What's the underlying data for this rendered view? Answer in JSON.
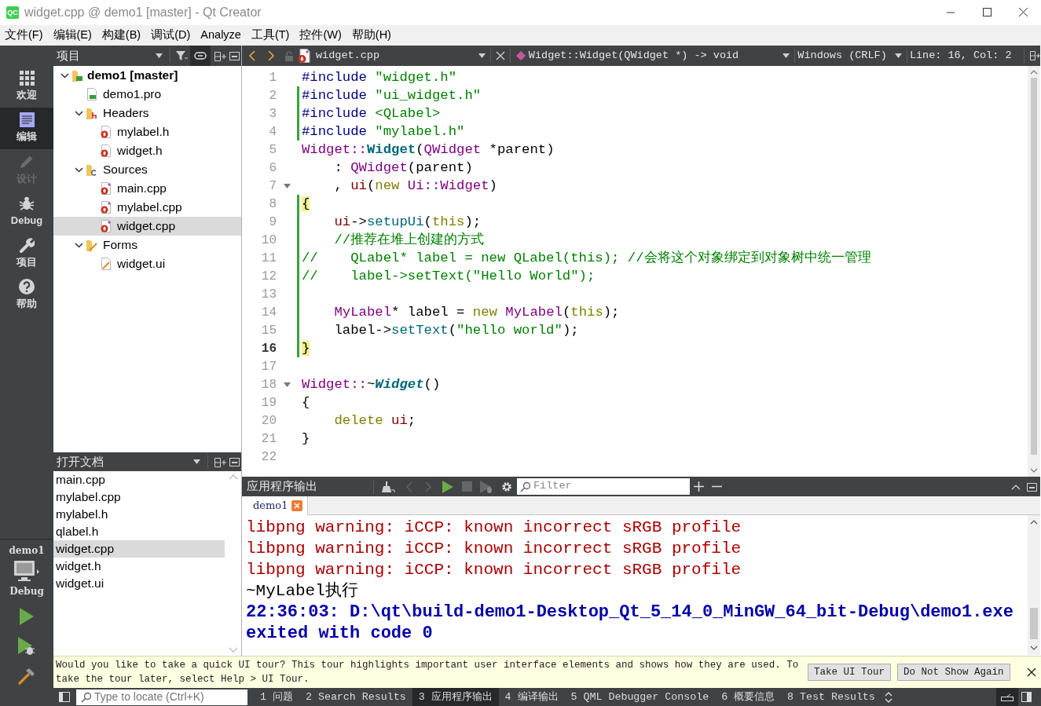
{
  "window": {
    "logo": "QC",
    "title": "widget.cpp @ demo1 [master] - Qt Creator"
  },
  "menu": [
    "文件(F)",
    "编辑(E)",
    "构建(B)",
    "调试(D)",
    "Analyze",
    "工具(T)",
    "控件(W)",
    "帮助(H)"
  ],
  "mode_bar": {
    "modes": [
      {
        "label": "欢迎",
        "kind": "welcome",
        "selected": false,
        "disabled": false
      },
      {
        "label": "编辑",
        "kind": "edit",
        "selected": true,
        "disabled": false
      },
      {
        "label": "设计",
        "kind": "design",
        "selected": false,
        "disabled": true
      },
      {
        "label": "Debug",
        "kind": "debug",
        "selected": false,
        "disabled": false
      },
      {
        "label": "项目",
        "kind": "projects",
        "selected": false,
        "disabled": false
      },
      {
        "label": "帮助",
        "kind": "help",
        "selected": false,
        "disabled": false
      }
    ],
    "kit": {
      "project": "demo1",
      "build": "Debug"
    }
  },
  "project_panel": {
    "title": "项目",
    "tree": [
      {
        "label": "demo1 [master]",
        "kind": "project",
        "expanded": true,
        "selected": false,
        "children": [
          {
            "label": "demo1.pro",
            "kind": "pro",
            "selected": false
          },
          {
            "label": "Headers",
            "kind": "folder-headers",
            "expanded": true,
            "selected": false,
            "children": [
              {
                "label": "mylabel.h",
                "kind": "header",
                "selected": false
              },
              {
                "label": "widget.h",
                "kind": "header",
                "selected": false
              }
            ]
          },
          {
            "label": "Sources",
            "kind": "folder-sources",
            "expanded": true,
            "selected": false,
            "children": [
              {
                "label": "main.cpp",
                "kind": "source",
                "selected": false
              },
              {
                "label": "mylabel.cpp",
                "kind": "source",
                "selected": false
              },
              {
                "label": "widget.cpp",
                "kind": "source",
                "selected": true
              }
            ]
          },
          {
            "label": "Forms",
            "kind": "folder-forms",
            "expanded": true,
            "selected": false,
            "children": [
              {
                "label": "widget.ui",
                "kind": "form",
                "selected": false
              }
            ]
          }
        ]
      }
    ]
  },
  "open_documents": {
    "title": "打开文档",
    "items": [
      {
        "label": "main.cpp",
        "selected": false
      },
      {
        "label": "mylabel.cpp",
        "selected": false
      },
      {
        "label": "mylabel.h",
        "selected": false
      },
      {
        "label": "qlabel.h",
        "selected": false
      },
      {
        "label": "widget.cpp",
        "selected": true
      },
      {
        "label": "widget.h",
        "selected": false
      },
      {
        "label": "widget.ui",
        "selected": false
      }
    ]
  },
  "editor": {
    "file": "widget.cpp",
    "symbol": "Widget::Widget(QWidget *) -> void",
    "line_ending": "Windows (CRLF)",
    "position": "Line: 16, Col: 2",
    "lines": [
      {
        "number": "1",
        "changed": false,
        "current": false,
        "foldable": false,
        "tokens": [
          {
            "text": "#include",
            "kind": "preproc"
          },
          {
            "text": " \"widget.h\"",
            "kind": "string"
          }
        ]
      },
      {
        "number": "2",
        "changed": true,
        "current": false,
        "foldable": false,
        "tokens": [
          {
            "text": "#include",
            "kind": "preproc"
          },
          {
            "text": " \"ui_widget.h\"",
            "kind": "string"
          }
        ]
      },
      {
        "number": "3",
        "changed": true,
        "current": false,
        "foldable": false,
        "tokens": [
          {
            "text": "#include",
            "kind": "preproc"
          },
          {
            "text": " <QLabel>",
            "kind": "string"
          }
        ]
      },
      {
        "number": "4",
        "changed": true,
        "current": false,
        "foldable": false,
        "tokens": [
          {
            "text": "#include",
            "kind": "preproc"
          },
          {
            "text": " \"mylabel.h\"",
            "kind": "string"
          }
        ]
      },
      {
        "number": "5",
        "changed": false,
        "current": false,
        "foldable": false,
        "tokens": [
          {
            "text": "Widget::",
            "kind": "type"
          },
          {
            "text": "Widget",
            "kind": "func-def"
          },
          {
            "text": "(",
            "kind": "plain"
          },
          {
            "text": "QWidget",
            "kind": "type"
          },
          {
            "text": " *parent)",
            "kind": "plain"
          }
        ]
      },
      {
        "number": "6",
        "changed": false,
        "current": false,
        "foldable": false,
        "tokens": [
          {
            "text": "    : ",
            "kind": "plain"
          },
          {
            "text": "QWidget",
            "kind": "type"
          },
          {
            "text": "(parent)",
            "kind": "plain"
          }
        ]
      },
      {
        "number": "7",
        "changed": false,
        "current": false,
        "foldable": true,
        "tokens": [
          {
            "text": "    , ",
            "kind": "plain"
          },
          {
            "text": "ui",
            "kind": "member"
          },
          {
            "text": "(",
            "kind": "plain"
          },
          {
            "text": "new",
            "kind": "keyword"
          },
          {
            "text": " Ui::Widget",
            "kind": "type"
          },
          {
            "text": ")",
            "kind": "plain"
          }
        ]
      },
      {
        "number": "8",
        "changed": true,
        "current": false,
        "foldable": false,
        "tokens": [
          {
            "text": "{",
            "kind": "brace"
          }
        ]
      },
      {
        "number": "9",
        "changed": true,
        "current": false,
        "foldable": false,
        "tokens": [
          {
            "text": "    ui",
            "kind": "member"
          },
          {
            "text": "->",
            "kind": "plain"
          },
          {
            "text": "setupUi",
            "kind": "func"
          },
          {
            "text": "(",
            "kind": "plain"
          },
          {
            "text": "this",
            "kind": "keyword"
          },
          {
            "text": ");",
            "kind": "plain"
          }
        ]
      },
      {
        "number": "10",
        "changed": true,
        "current": false,
        "foldable": false,
        "tokens": [
          {
            "text": "    //推荐在堆上创建的方式",
            "kind": "comment"
          }
        ]
      },
      {
        "number": "11",
        "changed": true,
        "current": false,
        "foldable": false,
        "tokens": [
          {
            "text": "//    QLabel* label = new QLabel(this); //会将这个对象绑定到对象树中统一管理",
            "kind": "comment"
          }
        ]
      },
      {
        "number": "12",
        "changed": true,
        "current": false,
        "foldable": false,
        "tokens": [
          {
            "text": "//    label->setText(\"Hello World\");",
            "kind": "comment"
          }
        ]
      },
      {
        "number": "13",
        "changed": true,
        "current": false,
        "foldable": false
      },
      {
        "number": "14",
        "changed": true,
        "current": false,
        "foldable": false,
        "tokens": [
          {
            "text": "    MyLabel",
            "kind": "type"
          },
          {
            "text": "* label = ",
            "kind": "plain"
          },
          {
            "text": "new",
            "kind": "keyword"
          },
          {
            "text": " MyLabel",
            "kind": "type"
          },
          {
            "text": "(",
            "kind": "plain"
          },
          {
            "text": "this",
            "kind": "keyword"
          },
          {
            "text": ");",
            "kind": "plain"
          }
        ]
      },
      {
        "number": "15",
        "changed": true,
        "current": false,
        "foldable": false,
        "tokens": [
          {
            "text": "    label->",
            "kind": "plain"
          },
          {
            "text": "setText",
            "kind": "func"
          },
          {
            "text": "(",
            "kind": "plain"
          },
          {
            "text": "\"hello world\"",
            "kind": "string"
          },
          {
            "text": ");",
            "kind": "plain"
          }
        ]
      },
      {
        "number": "16",
        "changed": true,
        "current": true,
        "foldable": false,
        "tokens": [
          {
            "text": "}",
            "kind": "brace"
          }
        ]
      },
      {
        "number": "17",
        "changed": false,
        "current": false,
        "foldable": false
      },
      {
        "number": "18",
        "changed": false,
        "current": false,
        "foldable": true,
        "tokens": [
          {
            "text": "Widget::",
            "kind": "type"
          },
          {
            "text": "~",
            "kind": "plain"
          },
          {
            "text": "Widget",
            "kind": "dtor-def"
          },
          {
            "text": "()",
            "kind": "plain"
          }
        ]
      },
      {
        "number": "19",
        "changed": false,
        "current": false,
        "foldable": false,
        "tokens": [
          {
            "text": "{",
            "kind": "plain"
          }
        ]
      },
      {
        "number": "20",
        "changed": false,
        "current": false,
        "foldable": false,
        "tokens": [
          {
            "text": "    delete",
            "kind": "keyword"
          },
          {
            "text": " ui",
            "kind": "member"
          },
          {
            "text": ";",
            "kind": "plain"
          }
        ]
      },
      {
        "number": "21",
        "changed": false,
        "current": false,
        "foldable": false,
        "tokens": [
          {
            "text": "}",
            "kind": "plain"
          }
        ]
      },
      {
        "number": "22",
        "changed": false,
        "current": false,
        "foldable": false
      }
    ]
  },
  "output": {
    "title": "应用程序输出",
    "filter_placeholder": "Filter",
    "tabs": [
      {
        "label": "demo1",
        "selected": true
      }
    ],
    "lines": [
      {
        "text": "libpng warning: iCCP: known incorrect sRGB profile",
        "kind": "error"
      },
      {
        "text": "libpng warning: iCCP: known incorrect sRGB profile",
        "kind": "error"
      },
      {
        "text": "libpng warning: iCCP: known incorrect sRGB profile",
        "kind": "error"
      },
      {
        "text": "~MyLabel执行",
        "kind": "plain"
      },
      {
        "text": "22:36:03: D:\\qt\\build-demo1-Desktop_Qt_5_14_0_MinGW_64_bit-Debug\\demo1.exe exited with code 0",
        "kind": "info"
      }
    ]
  },
  "info_bar": {
    "message": "Would you like to take a quick UI tour? This tour highlights important user interface elements and shows how they are used. To take the tour later, select Help > UI Tour.",
    "buttons": [
      "Take UI Tour",
      "Do Not Show Again"
    ]
  },
  "status_bar": {
    "locator_placeholder": "Type to locate (Ctrl+K)",
    "panes": [
      {
        "label": "1 问题",
        "selected": false
      },
      {
        "label": "2 Search Results",
        "selected": false
      },
      {
        "label": "3 应用程序输出",
        "selected": true
      },
      {
        "label": "4 编译输出",
        "selected": false
      },
      {
        "label": "5 QML Debugger Console",
        "selected": false
      },
      {
        "label": "6 概要信息",
        "selected": false
      },
      {
        "label": "8 Test Results",
        "selected": false
      }
    ]
  }
}
